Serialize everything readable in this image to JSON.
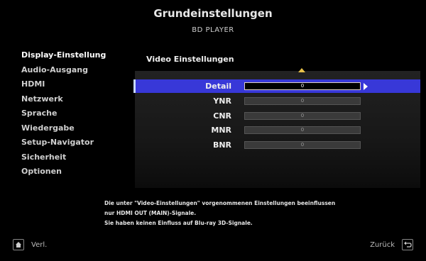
{
  "header": {
    "title": "Grundeinstellungen",
    "subtitle": "BD PLAYER"
  },
  "sidebar": {
    "items": [
      {
        "label": "Display-Einstellung"
      },
      {
        "label": "Audio-Ausgang"
      },
      {
        "label": "HDMI"
      },
      {
        "label": "Netzwerk"
      },
      {
        "label": "Sprache"
      },
      {
        "label": "Wiedergabe"
      },
      {
        "label": "Setup-Navigator"
      },
      {
        "label": "Sicherheit"
      },
      {
        "label": "Optionen"
      }
    ]
  },
  "main": {
    "section_title": "Video Einstellungen",
    "rows": [
      {
        "label": "Detail",
        "value": "0"
      },
      {
        "label": "YNR",
        "value": "0"
      },
      {
        "label": "CNR",
        "value": "0"
      },
      {
        "label": "MNR",
        "value": "0"
      },
      {
        "label": "BNR",
        "value": "0"
      }
    ]
  },
  "info": {
    "line1": "Die unter \"Video-Einstellungen\" vorgenommenen Einstellungen beeinflussen",
    "line2": "nur HDMI OUT (MAIN)-Signale.",
    "line3": "Sie haben keinen Einfluss auf Blu-ray 3D-Signale."
  },
  "footer": {
    "left_label": "Verl.",
    "right_label": "Zurück"
  },
  "colors": {
    "selected_row": "#3838d8",
    "arrow_accent": "#e8c24a"
  }
}
